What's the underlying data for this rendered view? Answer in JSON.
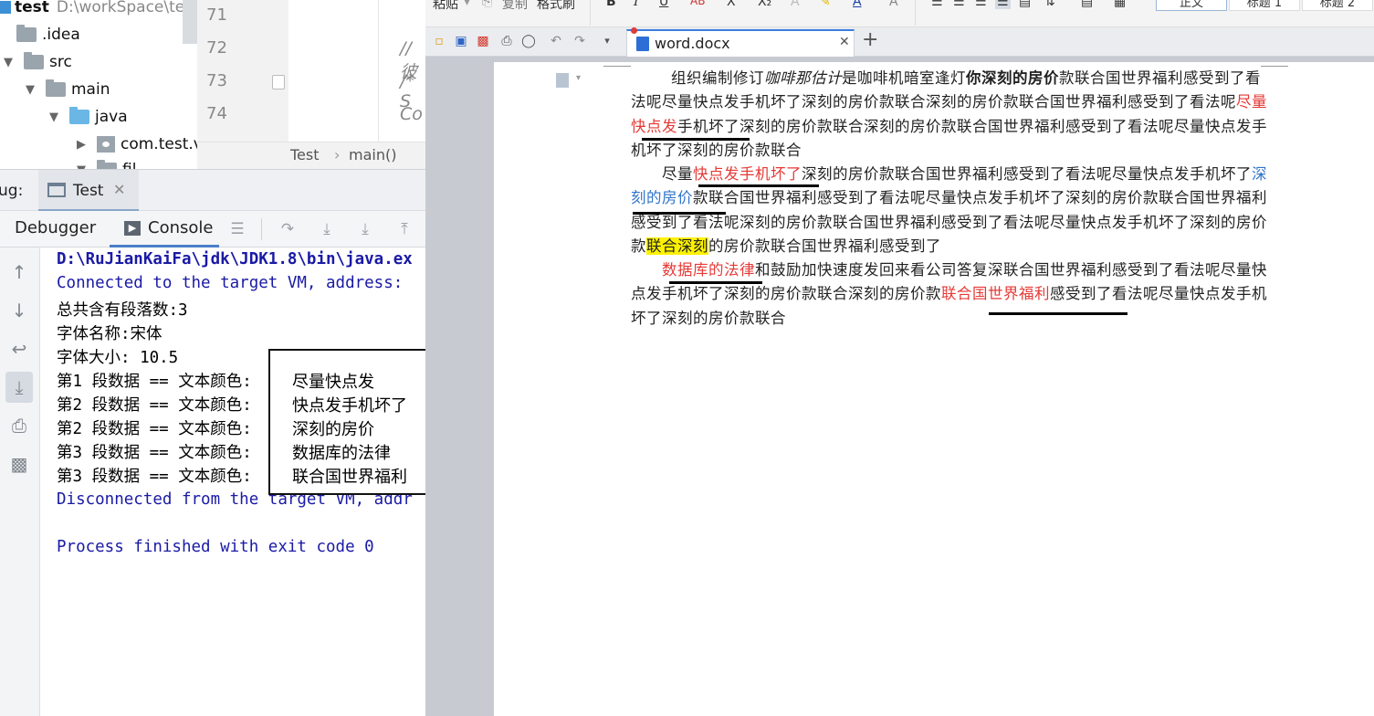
{
  "project_tree": {
    "root_label": "test",
    "root_path": "D:\\workSpace\\test",
    "items": [
      {
        "label": ".idea",
        "type": "folder"
      },
      {
        "label": "src",
        "type": "folder"
      },
      {
        "label": "main",
        "type": "folder"
      },
      {
        "label": "java",
        "type": "source-folder"
      },
      {
        "label": "com.test.v",
        "type": "package"
      },
      {
        "label": "fil",
        "type": "folder"
      }
    ]
  },
  "editor": {
    "line_numbers": [
      "71",
      "72",
      "73",
      "74"
    ],
    "code_lines": [
      "",
      "//彼",
      "/* S",
      "Co"
    ],
    "breadcrumb": {
      "class": "Test",
      "method": "main()"
    }
  },
  "debug_panel": {
    "prefix": "ug:",
    "run_tab": "Test",
    "tabs": {
      "debugger": "Debugger",
      "console": "Console"
    }
  },
  "console": {
    "lines": [
      {
        "text": "D:\\RuJianKaiFa\\jdk\\JDK1.8\\bin\\java.ex",
        "style": "blue"
      },
      {
        "text": "Connected to the target VM, address:",
        "style": "blue"
      },
      {
        "text": "总共含有段落数:3",
        "style": "normal"
      },
      {
        "text": "字体名称:宋体",
        "style": "normal"
      },
      {
        "text": "字体大小: 10.5",
        "style": "normal"
      },
      {
        "text": "第1 段数据 == 文本颜色:",
        "style": "normal"
      },
      {
        "text": "第2 段数据 == 文本颜色:",
        "style": "normal"
      },
      {
        "text": "第2 段数据 == 文本颜色:",
        "style": "normal"
      },
      {
        "text": "第3 段数据 == 文本颜色:",
        "style": "normal"
      },
      {
        "text": "第3 段数据 == 文本颜色:",
        "style": "normal"
      },
      {
        "text": "Disconnected from the target VM, addr",
        "style": "blue"
      },
      {
        "text": "",
        "style": "normal"
      },
      {
        "text": "Process finished with exit code 0",
        "style": "blue"
      }
    ]
  },
  "overlay_box": {
    "items": [
      "尽量快点发",
      "快点发手机坏了",
      "深刻的房价",
      "数据库的法律",
      "联合国世界福利"
    ]
  },
  "wps": {
    "ribbon": {
      "paste": "粘贴",
      "copy": "复制",
      "format_painter": "格式刷",
      "styles": [
        "正文",
        "标题 1",
        "标题 2"
      ]
    },
    "doc_tab": "word.docx",
    "document": {
      "p1": {
        "a": "组织编制修订",
        "b_italic": "咖啡那估计",
        "c": "是咖啡机暗室逢灯",
        "d_bold": "你深刻的房价",
        "e": "款联合国世界福利感受到了看法呢尽量快点发手机坏了深刻的房价款联合深刻的房价款联合国世界福利感受到了看法呢",
        "f_red": "尽量快点发",
        "g": "手机坏了深刻的房价款联合深刻的房价款联合国世界福利感受到了看法呢尽量快点发手机坏了深刻的房价款联合"
      },
      "p2": {
        "a": "尽量",
        "b_red": "快点发手机坏了",
        "c": "深刻的房价款联合国世界福利感受到了看法呢尽量快点发手机坏了",
        "d_blue": "深刻的房价",
        "e": "款联合国世界福利感受到了看法呢尽量快点发手机坏了深刻的房价款联合国世界福利感受到了看法呢深刻的房价款联合国世界福利感受到了看法呢尽量快点发手机坏了深刻的房价款",
        "f_highlight": "联合深刻",
        "g": "的房价款联合国世界福利感受到了"
      },
      "p3": {
        "a_red": "数据库的法律",
        "b": "和鼓励加快速度发回来看公司答复深联合国世界福利感受到了看法呢尽量快点发手机坏了深刻的房价款联合深刻的房价款",
        "c_red": "联合国世界福利",
        "d": "感受到了看法呢尽量快点发手机坏了深刻的房价款联合"
      }
    }
  },
  "colors": {
    "console_blue": "#1a1aa6",
    "doc_red": "#e53935",
    "doc_blue": "#2e74c9",
    "highlight": "#fff200",
    "workspace_bg": "#c7cad1"
  }
}
